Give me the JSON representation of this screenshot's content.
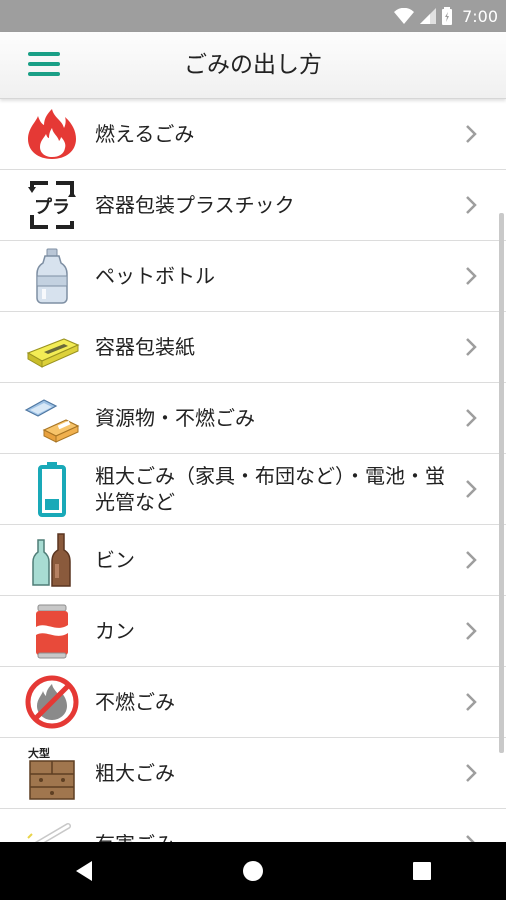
{
  "status_bar": {
    "time": "7:00"
  },
  "app_bar": {
    "title": "ごみの出し方"
  },
  "items": [
    {
      "label": "燃えるごみ",
      "icon": "flame-icon"
    },
    {
      "label": "容器包装プラスチック",
      "icon": "plastic-recycle-icon"
    },
    {
      "label": "ペットボトル",
      "icon": "pet-bottle-icon"
    },
    {
      "label": "容器包装紙",
      "icon": "paper-box-icon"
    },
    {
      "label": "資源物・不燃ごみ",
      "icon": "recyclables-icon"
    },
    {
      "label": "粗大ごみ（家具・布団など）・電池・蛍光管など",
      "icon": "battery-icon"
    },
    {
      "label": "ビン",
      "icon": "glass-bottles-icon"
    },
    {
      "label": "カン",
      "icon": "can-icon"
    },
    {
      "label": "不燃ごみ",
      "icon": "no-burn-icon"
    },
    {
      "label": "粗大ごみ",
      "icon": "furniture-icon"
    },
    {
      "label": "有害ごみ",
      "icon": "hazardous-icon"
    }
  ],
  "colors": {
    "accent": "#1a9f86",
    "status_bar": "#9e9e9e"
  }
}
